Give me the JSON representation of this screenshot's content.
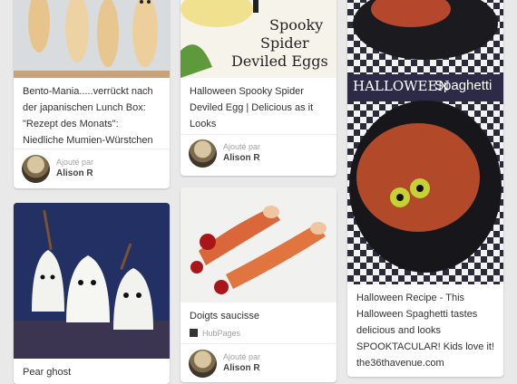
{
  "pins": [
    {
      "title": "Bento-Mania.....verrückt nach der japanischen Lunch Box: \"Rezept des Monats\": Niedliche Mumien-Würstchen",
      "pinned_by": "Ajouté par",
      "pinner": "Alison R"
    },
    {
      "title": "Halloween Spooky Spider Deviled Egg | Delicious as it Looks",
      "image_text": [
        "Spooky",
        "Spider",
        "Deviled Eggs"
      ],
      "pinned_by": "Ajouté par",
      "pinner": "Alison R"
    },
    {
      "title": "Halloween Recipe - This Halloween Spaghetti tastes delicious and looks SPOOKTACULAR! Kids love it! the36thavenue.com",
      "image_text": [
        "HALLOWEEN",
        "Spaghetti"
      ]
    },
    {
      "title": "Pear ghost"
    },
    {
      "title": "Doigts saucisse",
      "source": "HubPages",
      "pinned_by": "Ajouté par",
      "pinner": "Alison R"
    }
  ],
  "colors": {
    "background": "#e9e9e9",
    "card": "#ffffff",
    "title_text": "#333333",
    "meta_text": "#a3a3a3"
  }
}
